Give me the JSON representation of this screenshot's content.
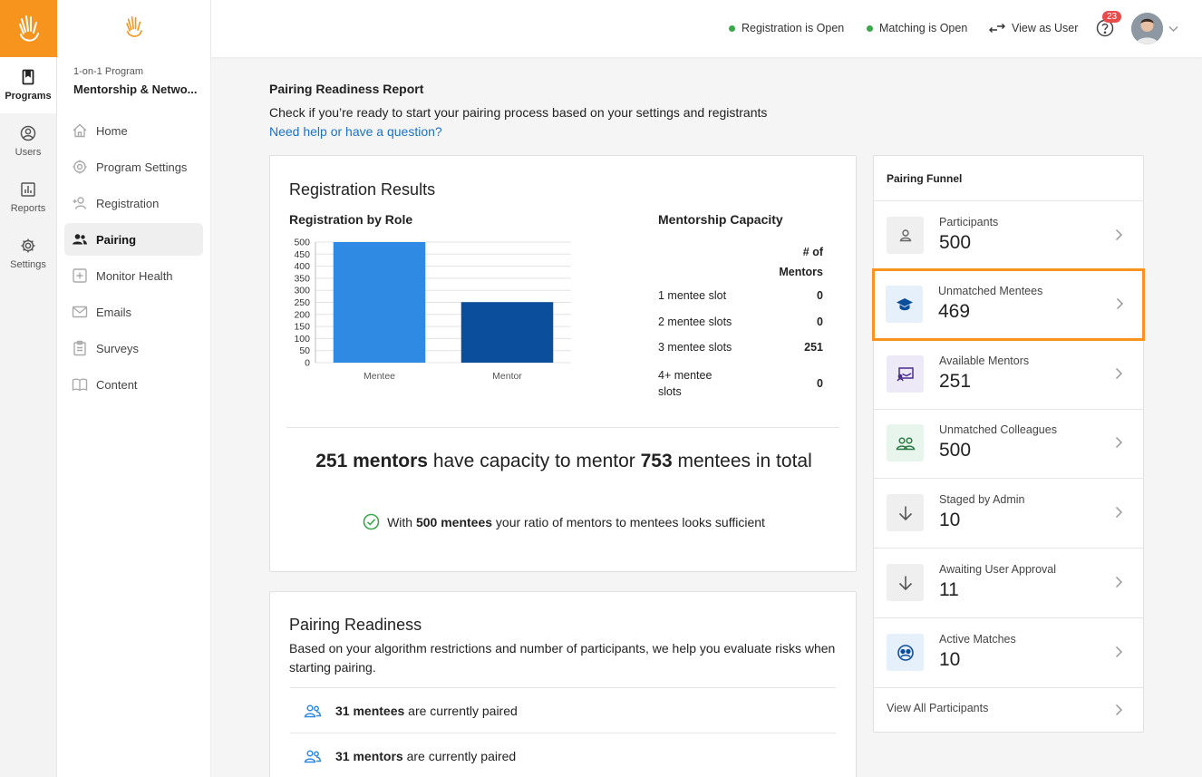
{
  "rail": {
    "items": [
      {
        "label": "Programs",
        "active": true
      },
      {
        "label": "Users"
      },
      {
        "label": "Reports"
      },
      {
        "label": "Settings"
      }
    ]
  },
  "program": {
    "subtitle": "1-on-1 Program",
    "title": "Mentorship & Netwo...",
    "nav": [
      "Home",
      "Program Settings",
      "Registration",
      "Pairing",
      "Monitor Health",
      "Emails",
      "Surveys",
      "Content"
    ],
    "active": "Pairing"
  },
  "topbar": {
    "registration_status": "Registration is Open",
    "matching_status": "Matching is Open",
    "view_as_user": "View as User",
    "notification_count": "23",
    "status_color": "#3aa84a",
    "badge_color": "#e94b4b"
  },
  "report": {
    "title": "Pairing Readiness Report",
    "description": "Check if you’re ready to start your pairing process based on your settings and registrants",
    "help_link": "Need help or have a question?"
  },
  "registration": {
    "title": "Registration Results",
    "chart_title": "Registration by Role",
    "capacity_title": "Mentorship Capacity",
    "capacity_header_1": "# of",
    "capacity_header_2": "Mentors",
    "capacity_rows": [
      {
        "label": "1 mentee slot",
        "value": "0"
      },
      {
        "label": "2 mentee slots",
        "value": "0"
      },
      {
        "label": "3 mentee slots",
        "value": "251"
      },
      {
        "label_1": "4+ mentee",
        "label_2": "slots",
        "value": "0"
      }
    ],
    "summary": {
      "mentors": "251 mentors",
      "mid": " have capacity to mentor ",
      "mentees": "753",
      "end": " mentees in total"
    },
    "sufficient": {
      "pre": "With ",
      "bold": "500 mentees",
      "post": " your ratio of mentors to mentees looks sufficient"
    }
  },
  "chart_data": {
    "type": "bar",
    "categories": [
      "Mentee",
      "Mentor"
    ],
    "values": [
      500,
      251
    ],
    "colors": [
      "#2f8ae3",
      "#0b4f9c"
    ],
    "yticks": [
      0,
      50,
      100,
      150,
      200,
      250,
      300,
      350,
      400,
      450,
      500
    ],
    "ylim": [
      0,
      500
    ],
    "grid": true
  },
  "readiness": {
    "title": "Pairing Readiness",
    "description": "Based on your algorithm restrictions and number of participants, we help you evaluate risks when starting pairing.",
    "rows": [
      {
        "bold": "31 mentees",
        "text": " are currently paired"
      },
      {
        "bold": "31 mentors",
        "text": " are currently paired"
      }
    ]
  },
  "funnel": {
    "title": "Pairing Funnel",
    "items": [
      {
        "label": "Participants",
        "value": "500",
        "icon": "person-icon",
        "bg": "#efefef"
      },
      {
        "label": "Unmatched Mentees",
        "value": "469",
        "icon": "graduation-cap-icon",
        "bg": "#e6f0fb",
        "highlight": true
      },
      {
        "label": "Available Mentors",
        "value": "251",
        "icon": "teacher-board-icon",
        "bg": "#ede9f6"
      },
      {
        "label": "Unmatched Colleagues",
        "value": "500",
        "icon": "colleagues-icon",
        "bg": "#e8f5ec"
      },
      {
        "label": "Staged by Admin",
        "value": "10",
        "icon": "arrow-down-icon",
        "bg": "#efefef"
      },
      {
        "label": "Awaiting User Approval",
        "value": "11",
        "icon": "arrow-down-icon",
        "bg": "#efefef"
      },
      {
        "label": "Active Matches",
        "value": "10",
        "icon": "match-icon",
        "bg": "#e6f0fb"
      }
    ],
    "footer": "View All Participants",
    "highlight_color": "#f7941d"
  }
}
